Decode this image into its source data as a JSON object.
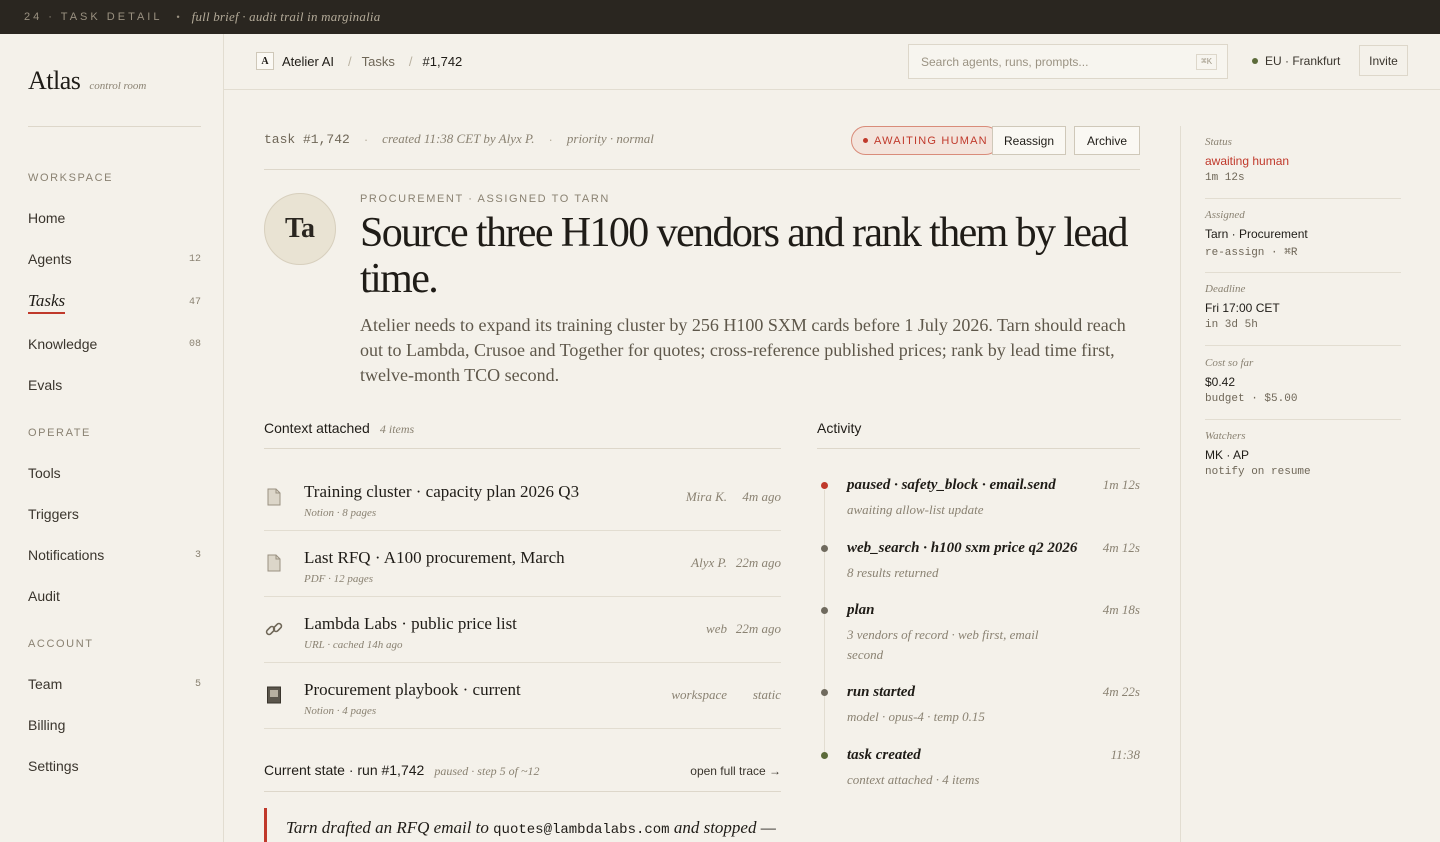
{
  "topstrip": {
    "label": "24 · TASK DETAIL",
    "note": "full brief · audit trail in marginalia"
  },
  "brand": {
    "name": "Atlas",
    "subtitle": "control room"
  },
  "nav": {
    "workspace_label": "WORKSPACE",
    "operate_label": "OPERATE",
    "account_label": "ACCOUNT",
    "items": [
      {
        "label": "Home",
        "count": ""
      },
      {
        "label": "Agents",
        "count": "12"
      },
      {
        "label": "Tasks",
        "count": "47",
        "active": true
      },
      {
        "label": "Knowledge",
        "count": "08"
      },
      {
        "label": "Evals",
        "count": ""
      },
      {
        "label": "Tools",
        "count": ""
      },
      {
        "label": "Triggers",
        "count": ""
      },
      {
        "label": "Notifications",
        "count": "3"
      },
      {
        "label": "Audit",
        "count": ""
      },
      {
        "label": "Team",
        "count": "5"
      },
      {
        "label": "Billing",
        "count": ""
      },
      {
        "label": "Settings",
        "count": ""
      }
    ]
  },
  "header": {
    "org_logo": "A",
    "org": "Atelier AI",
    "crumb_mid": "Tasks",
    "crumb_current": "#1,742",
    "search_placeholder": "Search agents, runs, prompts...",
    "search_shortcut": "⌘K",
    "region": "EU · Frankfurt",
    "invite": "Invite"
  },
  "task": {
    "id": "task #1,742",
    "created": "created 11:38 CET by Alyx P.",
    "priority": "priority · normal",
    "status_badge": "AWAITING HUMAN",
    "reassign": "Reassign",
    "archive": "Archive",
    "avatar": "Ta",
    "eyebrow": "PROCUREMENT · ASSIGNED TO TARN",
    "title": "Source three H100 vendors and rank them by lead time.",
    "description": "Atelier needs to expand its training cluster by 256 H100 SXM cards before 1 July 2026. Tarn should reach out to Lambda, Crusoe and Together for quotes; cross-reference published prices; rank by lead time first, twelve-month TCO second."
  },
  "context": {
    "heading": "Context attached",
    "count": "4 items",
    "items": [
      {
        "icon": "document-icon",
        "title": "Training cluster · capacity plan 2026 Q3",
        "sub": "Notion · 8 pages",
        "who": "Mira K.",
        "when": "4m ago"
      },
      {
        "icon": "document-icon",
        "title": "Last RFQ · A100 procurement, March",
        "sub": "PDF · 12 pages",
        "who": "Alyx P.",
        "when": "22m ago"
      },
      {
        "icon": "link-icon",
        "title": "Lambda Labs · public price list",
        "sub": "URL · cached 14h ago",
        "who": "web",
        "when": "22m ago"
      },
      {
        "icon": "book-icon",
        "title": "Procurement playbook · current",
        "sub": "Notion · 4 pages",
        "who": "workspace",
        "when": "static"
      }
    ]
  },
  "state": {
    "heading": "Current state · run #1,742",
    "sub": "paused · step 5 of ~12",
    "link": "open full trace →",
    "quote_pre": "Tarn drafted an RFQ email to",
    "quote_email": "quotes@lambdalabs.com",
    "quote_post": "and stopped —"
  },
  "activity": {
    "heading": "Activity",
    "items": [
      {
        "title": "paused · safety_block · email.send",
        "time": "1m 12s",
        "sub": "awaiting allow-list update",
        "color": "#c0392b"
      },
      {
        "title": "web_search · h100 sxm price q2 2026",
        "time": "4m 12s",
        "sub": "8 results returned",
        "color": "#6f6a5e"
      },
      {
        "title": "plan",
        "time": "4m 18s",
        "sub": "3 vendors of record · web first, email second",
        "color": "#6f6a5e"
      },
      {
        "title": "run started",
        "time": "4m 22s",
        "sub": "model · opus-4 · temp 0.15",
        "color": "#6f6a5e"
      },
      {
        "title": "task created",
        "time": "11:38",
        "sub": "context attached · 4 items",
        "color": "#5c6b3a"
      }
    ]
  },
  "rail": {
    "status": {
      "key": "Status",
      "value": "awaiting human",
      "meta": "1m 12s"
    },
    "assigned": {
      "key": "Assigned",
      "value": "Tarn · Procurement",
      "meta": "re-assign · ⌘R"
    },
    "deadline": {
      "key": "Deadline",
      "value": "Fri 17:00 CET",
      "meta": "in 3d 5h"
    },
    "cost": {
      "key": "Cost so far",
      "value": "$0.42",
      "meta": "budget · $5.00"
    },
    "watchers": {
      "key": "Watchers",
      "value": "MK · AP",
      "meta": "notify on resume"
    }
  },
  "colors": {
    "accent": "#c0392b",
    "online": "#5c6b3a",
    "background": "#f4f1ea",
    "topbar": "#2a2620"
  }
}
